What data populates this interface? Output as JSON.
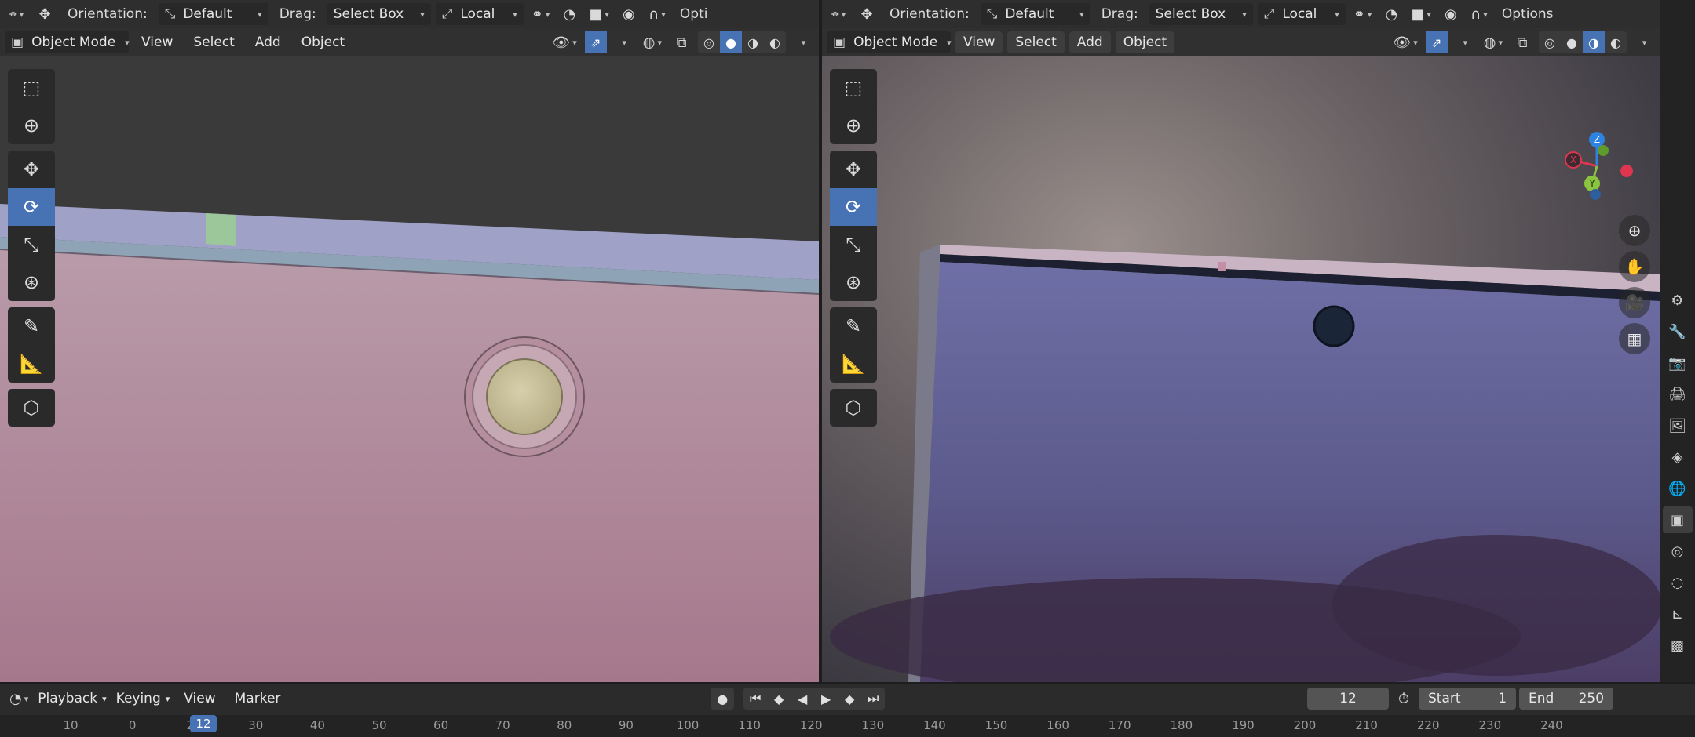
{
  "colors": {
    "accent": "#4772b3",
    "header_bg": "#2e2e2e",
    "field_bg": "#545454"
  },
  "viewports": [
    {
      "header": {
        "orientation_label": "Orientation:",
        "orientation_value": "Default",
        "drag_label": "Drag:",
        "drag_value": "Select Box",
        "pivot_value": "Local",
        "options_label": "Opti"
      },
      "mode": "Object Mode",
      "menus": [
        "View",
        "Select",
        "Add",
        "Object"
      ]
    },
    {
      "header": {
        "orientation_label": "Orientation:",
        "orientation_value": "Default",
        "drag_label": "Drag:",
        "drag_value": "Select Box",
        "pivot_value": "Local",
        "options_label": "Options"
      },
      "mode": "Object Mode",
      "menus": [
        "View",
        "Select",
        "Add",
        "Object"
      ],
      "gizmo": {
        "x": "X",
        "y": "Y",
        "z": "Z"
      }
    }
  ],
  "tools": [
    "select-box",
    "cursor",
    "move",
    "rotate",
    "scale",
    "transform",
    "annotate",
    "measure",
    "add-cube"
  ],
  "active_tool": "rotate",
  "timeline": {
    "menus": [
      "Playback",
      "Keying",
      "View",
      "Marker"
    ],
    "current_frame": "12",
    "start_label": "Start",
    "start_value": "1",
    "end_label": "End",
    "end_value": "250",
    "ticks": [
      "10",
      "0",
      "20",
      "30",
      "40",
      "50",
      "60",
      "70",
      "80",
      "90",
      "100",
      "110",
      "120",
      "130",
      "140",
      "150",
      "160",
      "170",
      "180",
      "190",
      "200",
      "210",
      "220",
      "230",
      "240"
    ]
  }
}
